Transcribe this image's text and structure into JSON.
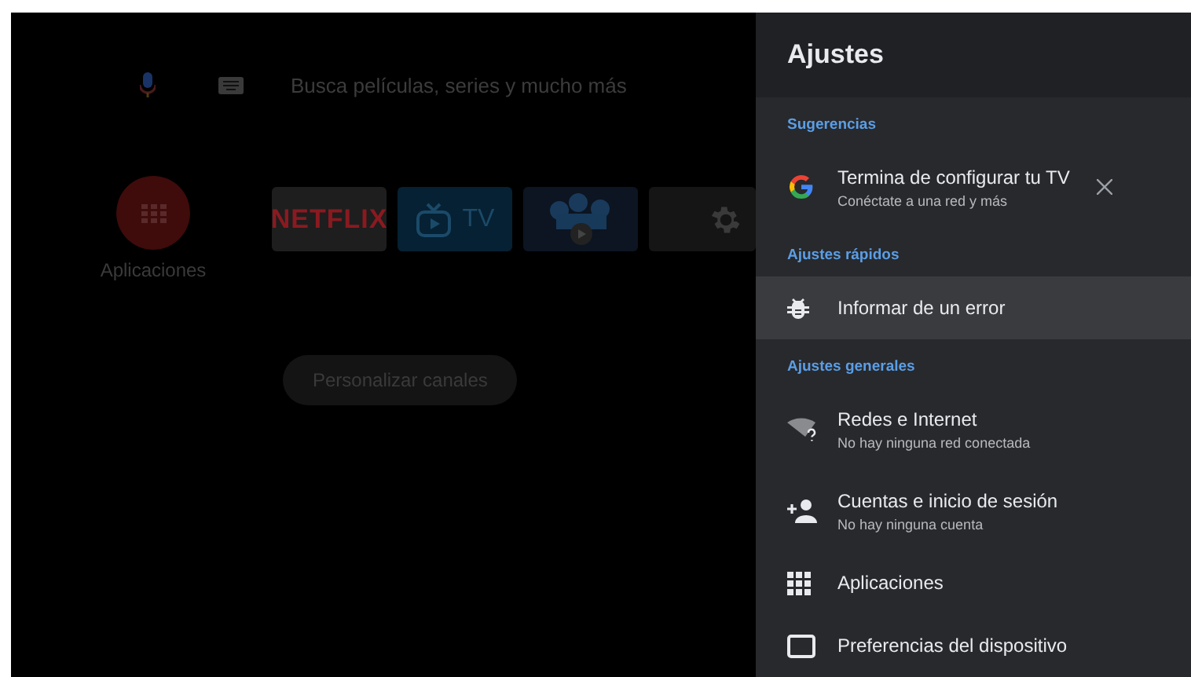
{
  "home": {
    "search": {
      "placeholder": "Busca películas, series y mucho más"
    },
    "apps_button": {
      "label": "Aplicaciones"
    },
    "tiles": [
      {
        "kind": "netflix",
        "label": "NETFLIX"
      },
      {
        "kind": "tv",
        "label": "TV"
      },
      {
        "kind": "media"
      },
      {
        "kind": "settings"
      }
    ],
    "customize_button": {
      "label": "Personalizar canales"
    }
  },
  "settings_panel": {
    "title": "Ajustes",
    "sections": [
      {
        "heading": "Sugerencias",
        "items": [
          {
            "kind": "suggestion",
            "title": "Termina de configurar tu TV",
            "subtitle": "Conéctate a una red y más",
            "selected": false
          }
        ]
      },
      {
        "heading": "Ajustes rápidos",
        "items": [
          {
            "kind": "setting",
            "title": "Informar de un error",
            "selected": true
          }
        ]
      },
      {
        "heading": "Ajustes generales",
        "items": [
          {
            "kind": "setting",
            "title": "Redes e Internet",
            "subtitle": "No hay ninguna red conectada",
            "selected": false
          },
          {
            "kind": "setting",
            "title": "Cuentas e inicio de sesión",
            "subtitle": "No hay ninguna cuenta",
            "selected": false
          },
          {
            "kind": "setting",
            "title": "Aplicaciones",
            "selected": false
          },
          {
            "kind": "setting",
            "title": "Preferencias del dispositivo",
            "selected": false
          }
        ]
      }
    ]
  }
}
